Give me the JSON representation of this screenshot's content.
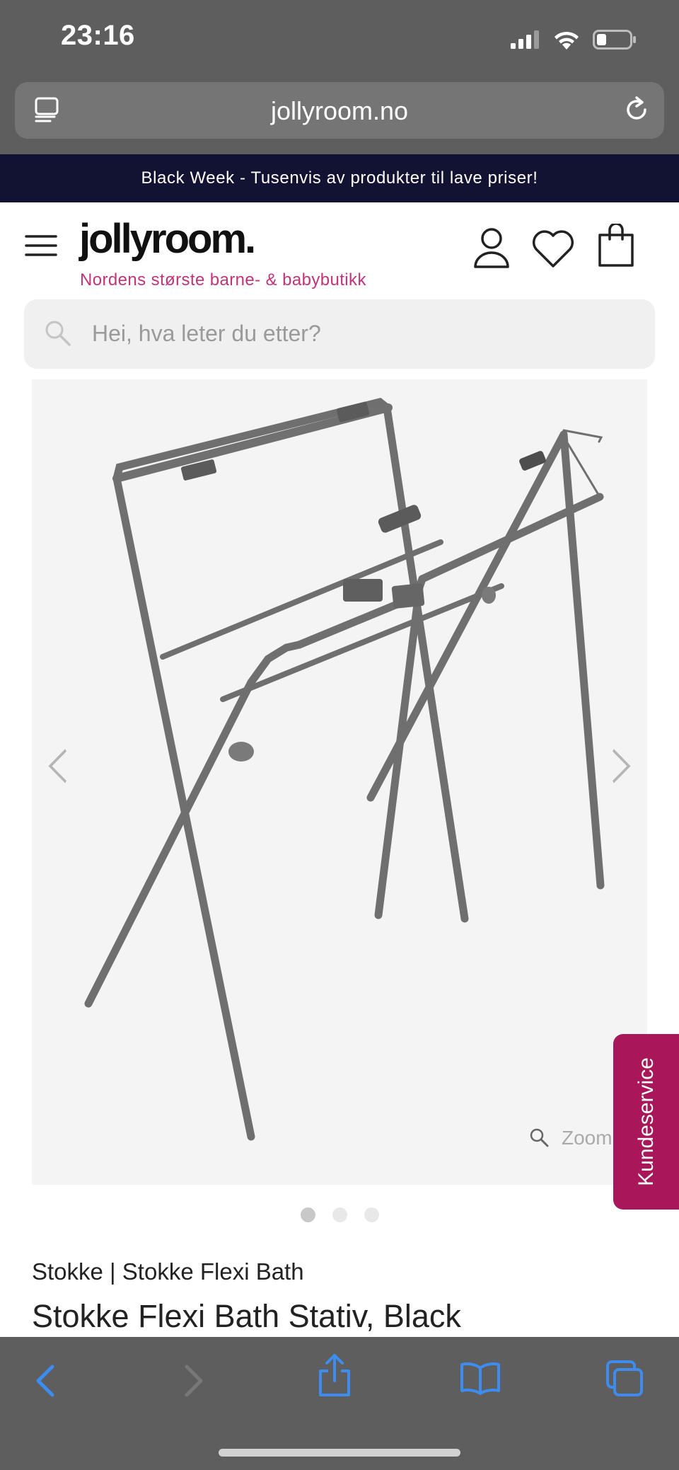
{
  "status_bar": {
    "time": "23:16"
  },
  "browser": {
    "url": "jollyroom.no"
  },
  "promo_banner": {
    "text": "Black Week - Tusenvis av produkter til lave priser!"
  },
  "header": {
    "logo": "jollyroom.",
    "tagline": "Nordens største barne- & babybutikk"
  },
  "search": {
    "placeholder": "Hei, hva leter du etter?"
  },
  "gallery": {
    "zoom_label": "Zoom",
    "slide_count": 3,
    "active_slide": 1
  },
  "customer_service": {
    "label": "Kundeservice"
  },
  "product": {
    "brand_line": "Stokke | Stokke Flexi Bath",
    "title": "Stokke Flexi Bath Stativ, Black"
  },
  "colors": {
    "promo_bg": "#121232",
    "tagline": "#c2347a",
    "customer_service_bg": "#a7175a",
    "browser_chrome": "#5e5e5e",
    "toolbar_icon": "#3d8cf0"
  },
  "icons": [
    "signal-icon",
    "wifi-icon",
    "battery-icon",
    "reader-icon",
    "reload-icon",
    "menu-icon",
    "account-icon",
    "wishlist-icon",
    "cart-icon",
    "search-icon",
    "prev-arrow-icon",
    "next-arrow-icon",
    "zoom-icon",
    "back-icon",
    "forward-icon",
    "share-icon",
    "bookmarks-icon",
    "tabs-icon"
  ]
}
